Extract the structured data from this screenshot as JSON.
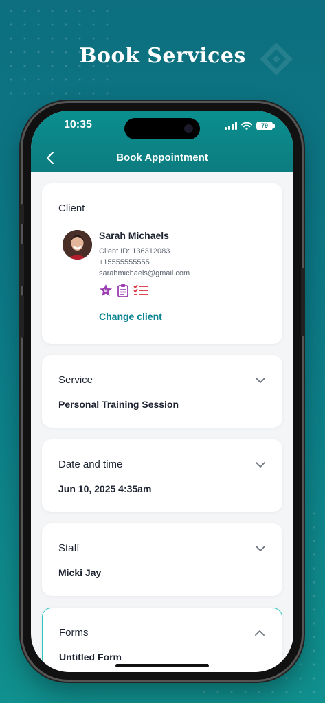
{
  "promo": {
    "title": "Book Services"
  },
  "status_bar": {
    "time": "10:35",
    "battery": "79"
  },
  "header": {
    "title": "Book Appointment",
    "back_icon": "chevron-left-icon"
  },
  "client": {
    "section_title": "Client",
    "name": "Sarah Michaels",
    "client_id": "Client ID: 136312083",
    "phone": "+15555555555",
    "email": "sarahmichaels@gmail.com",
    "badges": [
      "member-star-icon",
      "clipboard-list-icon",
      "checklist-icon"
    ],
    "change_label": "Change client"
  },
  "service": {
    "section_title": "Service",
    "value": "Personal Training Session"
  },
  "date_time": {
    "section_title": "Date and time",
    "value": "Jun 10, 2025 4:35am"
  },
  "staff": {
    "section_title": "Staff",
    "value": "Micki Jay"
  },
  "forms": {
    "section_title": "Forms",
    "value": "Untitled Form"
  },
  "colors": {
    "accent": "#0b8491",
    "header": "#0c7c80",
    "background": "#0d6f7f",
    "badge_purple": "#9b3fb0",
    "badge_red": "#d9333f",
    "forms_border": "#2ec5bf"
  }
}
